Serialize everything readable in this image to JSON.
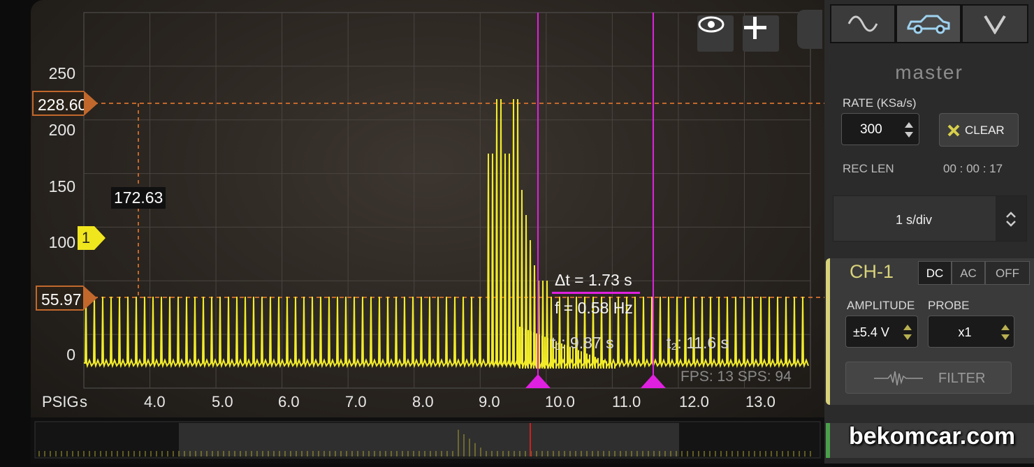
{
  "header_buttons": {
    "eye_icon": "eye-icon",
    "add_icon": "plus-icon"
  },
  "y_axis": {
    "ticks": [
      "250",
      "200",
      "150",
      "100",
      "0"
    ],
    "marker_upper": "228.60",
    "marker_lower": "55.97",
    "channel_marker": "1",
    "cursor_readout": "172.63"
  },
  "x_axis": {
    "unit_label": "PSIG",
    "unit": "s",
    "ticks": [
      "4.0",
      "5.0",
      "6.0",
      "7.0",
      "8.0",
      "9.0",
      "10.0",
      "11.0",
      "12.0",
      "13.0"
    ]
  },
  "measurements": {
    "delta_t": "Δt = 1.73 s",
    "freq": "f = 0.58 Hz",
    "t1": "t₁: 9.87 s",
    "t2": "t₂: 11.6 s"
  },
  "status": {
    "fps_sps": "FPS: 13  SPS: 94"
  },
  "sidebar": {
    "tabs": [
      {
        "name": "wave",
        "icon": "sine-wave-icon"
      },
      {
        "name": "car",
        "icon": "car-icon"
      },
      {
        "name": "v",
        "icon": "v-icon"
      }
    ],
    "master_label": "master",
    "rate_label": "RATE (KSa/s)",
    "rate_value": "300",
    "clear_label": "CLEAR",
    "rec_len_label": "REC LEN",
    "rec_len_value": "00 : 00 : 17",
    "timebase": "1 s/div"
  },
  "channel": {
    "name": "CH-1",
    "couplings": [
      "DC",
      "AC",
      "OFF"
    ],
    "selected_coupling": "DC",
    "amplitude_label": "AMPLITUDE",
    "amplitude_value": "±5.4 V",
    "probe_label": "PROBE",
    "probe_value": "x1",
    "filter_label": "FILTER"
  },
  "colors": {
    "trace": "#f2ec2a",
    "cursor": "#e020e0",
    "marker": "#c2682c",
    "channel_accent": "#d8d27a"
  },
  "watermark": "bekomcar.com"
}
